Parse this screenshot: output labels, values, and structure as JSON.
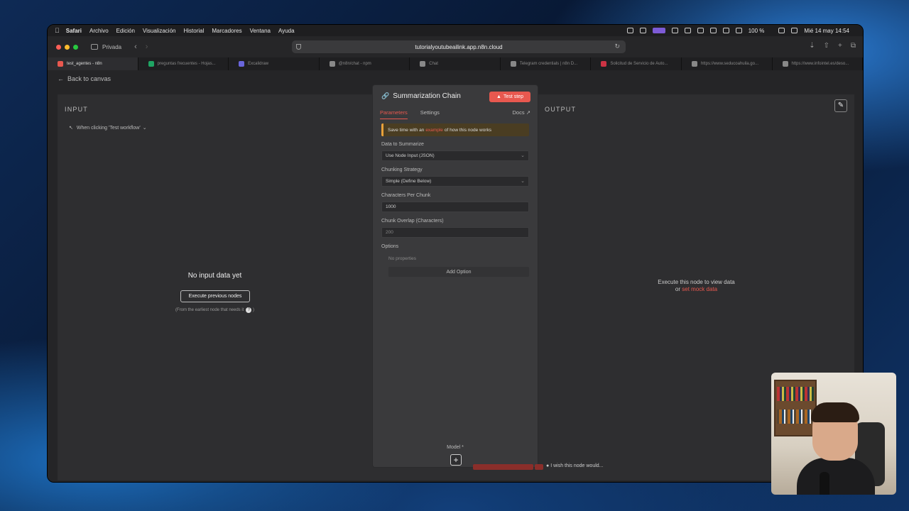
{
  "menubar": {
    "app_name": "Safari",
    "items": [
      "Archivo",
      "Edición",
      "Visualización",
      "Historial",
      "Marcadores",
      "Ventana",
      "Ayuda"
    ],
    "battery": "100 %",
    "datetime": "Mié 14 may 14:54"
  },
  "toolbar": {
    "private_label": "Privada",
    "url": "tutorialyoutubeailink.app.n8n.cloud"
  },
  "tabs": [
    {
      "label": "test_agentes - n8n",
      "color": "#e8584f",
      "active": true
    },
    {
      "label": "preguntas frecuentes - Hojas...",
      "color": "#1fa463",
      "active": false
    },
    {
      "label": "Excalidraw",
      "color": "#6965db",
      "active": false
    },
    {
      "label": "@n8n/chat - npm",
      "color": "#888888",
      "active": false
    },
    {
      "label": "Chat",
      "color": "#888888",
      "active": false
    },
    {
      "label": "Telegram credentials | n8n D...",
      "color": "#888888",
      "active": false
    },
    {
      "label": "Solicitud de Servicio de Auto...",
      "color": "#cc3344",
      "active": false
    },
    {
      "label": "https://www.seducoahuila.go...",
      "color": "#888888",
      "active": false
    },
    {
      "label": "https://www.infointel.es/deso...",
      "color": "#888888",
      "active": false
    }
  ],
  "canvas": {
    "back_label": "Back to canvas"
  },
  "input_panel": {
    "title": "INPUT",
    "trigger_label": "When clicking 'Test workflow'",
    "empty_title": "No input data yet",
    "execute_button": "Execute previous nodes",
    "hint": "(From the earliest node that needs it"
  },
  "node": {
    "title": "Summarization Chain",
    "test_step": "Test step",
    "tabs": {
      "parameters": "Parameters",
      "settings": "Settings",
      "docs": "Docs"
    },
    "notice": {
      "before": "Save time with an",
      "link": "example",
      "after": "of how this node works"
    },
    "fields": {
      "data_to_summarize": {
        "label": "Data to Summarize",
        "value": "Use Node Input (JSON)"
      },
      "chunking_strategy": {
        "label": "Chunking Strategy",
        "value": "Simple (Define Below)"
      },
      "chars_per_chunk": {
        "label": "Characters Per Chunk",
        "value": "1000"
      },
      "chunk_overlap": {
        "label": "Chunk Overlap (Characters)",
        "value": "200"
      }
    },
    "options_label": "Options",
    "no_properties": "No properties",
    "add_option": "Add Option",
    "model_label": "Model *"
  },
  "output_panel": {
    "title": "OUTPUT",
    "message_line1": "Execute this node to view data",
    "message_or": "or",
    "message_link": "set mock data",
    "wish": "I wish this node would..."
  }
}
